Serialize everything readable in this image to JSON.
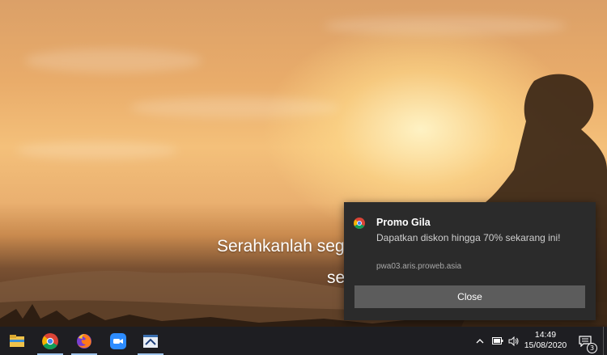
{
  "wallpaper": {
    "overlay_line1": "Serahkanlah seg",
    "overlay_line2": "se"
  },
  "toast": {
    "app_icon": "chrome-icon",
    "title": "Promo Gila",
    "body": "Dapatkan diskon hingga 70% sekarang ini!",
    "source": "pwa03.aris.proweb.asia",
    "close_label": "Close",
    "background": "#2b2b2b",
    "button_color": "#5c5c5c"
  },
  "taskbar": {
    "apps": [
      {
        "name": "file-explorer-icon",
        "active": false
      },
      {
        "name": "chrome-icon",
        "active": true
      },
      {
        "name": "firefox-icon",
        "active": true
      },
      {
        "name": "zoom-icon",
        "active": false
      },
      {
        "name": "sublime-app-icon",
        "active": true
      }
    ],
    "tray": [
      "chevron-up-icon",
      "battery-icon",
      "volume-icon"
    ],
    "time": "14:49",
    "date": "15/08/2020",
    "notification_count": "3",
    "background": "#1e1e22"
  }
}
